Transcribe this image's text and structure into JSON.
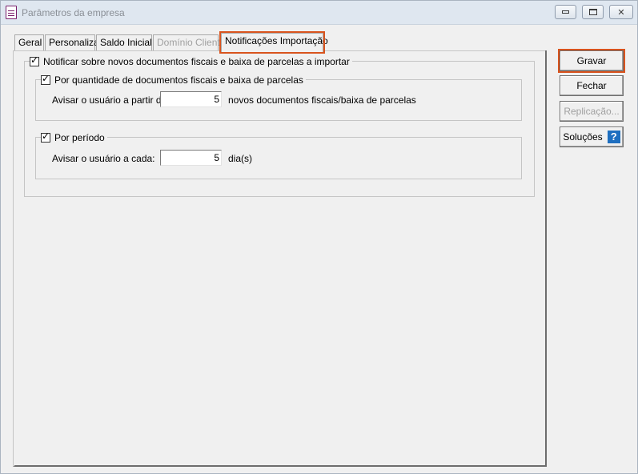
{
  "window": {
    "title": "Parâmetros da empresa",
    "controls": {
      "minimize": "minimize-icon",
      "maximize": "maximize-icon",
      "close": "close-icon"
    }
  },
  "tabs": [
    {
      "label": "Geral",
      "state": "normal"
    },
    {
      "label": "Personaliza",
      "state": "normal"
    },
    {
      "label": "Saldo Inicial",
      "state": "normal"
    },
    {
      "label": "Domínio Cliente",
      "state": "disabled"
    },
    {
      "label": "Notificações Importação",
      "state": "active"
    }
  ],
  "notifications": {
    "main_checkbox": {
      "label": "Notificar sobre novos documentos fiscais e baixa de parcelas a importar",
      "checked": true
    },
    "quantity_group": {
      "checkbox": {
        "label": "Por quantidade de documentos fiscais e baixa de parcelas",
        "checked": true
      },
      "field_label": "Avisar o usuário a partir de:",
      "value": "5",
      "suffix": "novos documentos fiscais/baixa de parcelas"
    },
    "period_group": {
      "checkbox": {
        "label": "Por período",
        "checked": true
      },
      "field_label": "Avisar o usuário a cada:",
      "value": "5",
      "suffix": "dia(s)"
    }
  },
  "buttons": {
    "gravar": "Gravar",
    "fechar": "Fechar",
    "replicacao": "Replicação...",
    "solucoes": "Soluções",
    "solucoes_icon": "?"
  },
  "colors": {
    "highlight": "#d9541e",
    "help_icon": "#1e6fc0"
  }
}
